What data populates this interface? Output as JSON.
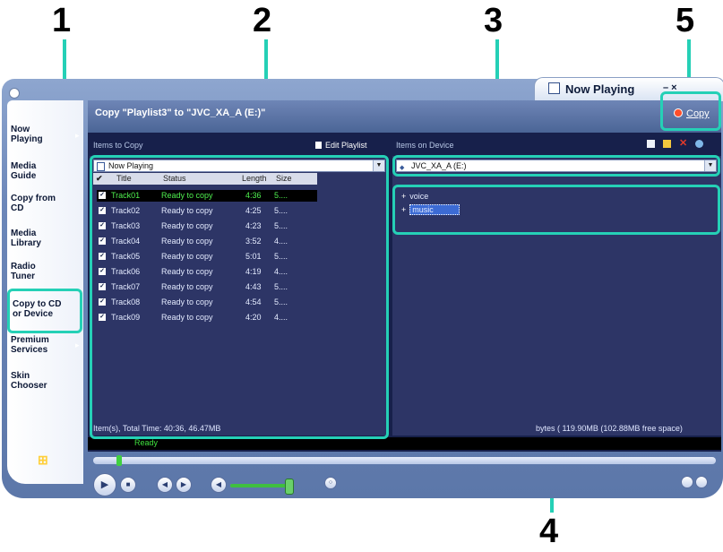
{
  "callouts": [
    "1",
    "2",
    "3",
    "4",
    "5"
  ],
  "window": {
    "tab_title": "Now Playing",
    "window_buttons": "– ×"
  },
  "taskbar": {
    "items": [
      {
        "label": "Now\nPlaying"
      },
      {
        "label": "Media\nGuide"
      },
      {
        "label": "Copy from\nCD"
      },
      {
        "label": "Media\nLibrary"
      },
      {
        "label": "Radio\nTuner"
      },
      {
        "label": "Copy to CD\nor Device"
      },
      {
        "label": "Premium\nServices"
      },
      {
        "label": "Skin\nChooser"
      }
    ]
  },
  "header": {
    "title": "Copy \"Playlist3\" to \"JVC_XA_A (E:)\"",
    "copy_label": "Copy"
  },
  "left_pane": {
    "heading": "Items to Copy",
    "edit_playlist": "Edit Playlist",
    "dropdown_value": "Now Playing",
    "columns": [
      "Title",
      "Status",
      "Length",
      "Size"
    ],
    "rows": [
      {
        "title": "Track01",
        "status": "Ready to copy",
        "length": "4:36",
        "size": "5...."
      },
      {
        "title": "Track02",
        "status": "Ready to copy",
        "length": "4:25",
        "size": "5...."
      },
      {
        "title": "Track03",
        "status": "Ready to copy",
        "length": "4:23",
        "size": "5...."
      },
      {
        "title": "Track04",
        "status": "Ready to copy",
        "length": "3:52",
        "size": "4...."
      },
      {
        "title": "Track05",
        "status": "Ready to copy",
        "length": "5:01",
        "size": "5...."
      },
      {
        "title": "Track06",
        "status": "Ready to copy",
        "length": "4:19",
        "size": "4...."
      },
      {
        "title": "Track07",
        "status": "Ready to copy",
        "length": "4:43",
        "size": "5...."
      },
      {
        "title": "Track08",
        "status": "Ready to copy",
        "length": "4:54",
        "size": "5...."
      },
      {
        "title": "Track09",
        "status": "Ready to copy",
        "length": "4:20",
        "size": "4...."
      }
    ],
    "status": "Item(s), Total Time: 40:36, 46.47MB"
  },
  "right_pane": {
    "heading": "Items on Device",
    "dropdown_value": "JVC_XA_A (E:)",
    "folders": [
      "voice",
      "music"
    ],
    "status": "bytes ( 119.90MB (102.88MB free space)"
  },
  "statusbar": {
    "ready": "Ready"
  },
  "colors": {
    "callout": "#25d0b6",
    "panel_bg": "#2d3566",
    "selected_text": "#4ff04f"
  }
}
